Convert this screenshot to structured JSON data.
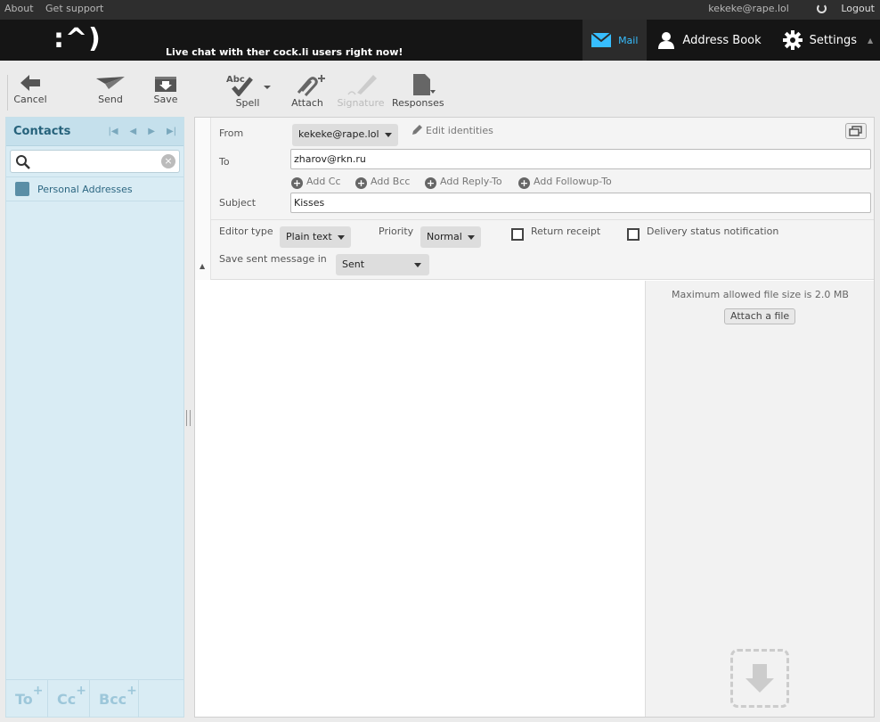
{
  "topline": {
    "about": "About",
    "support": "Get support",
    "user": "kekeke@rape.lol",
    "logout": "Logout"
  },
  "header": {
    "logo": ":^)",
    "motd": "Live chat with ther cock.li users right now!",
    "tasks": {
      "mail": "Mail",
      "addressbook": "Address Book",
      "settings": "Settings"
    }
  },
  "toolbar": {
    "cancel": "Cancel",
    "send": "Send",
    "save": "Save",
    "spell": "Spell",
    "spell_abc": "Abc",
    "attach": "Attach",
    "signature": "Signature",
    "responses": "Responses"
  },
  "sidebar": {
    "title": "Contacts",
    "search_value": "",
    "groups": [
      "Personal Addresses"
    ],
    "footer": {
      "to": "To",
      "cc": "Cc",
      "bcc": "Bcc"
    }
  },
  "compose": {
    "from_label": "From",
    "from_value": "kekeke@rape.lol",
    "edit_identities": "Edit identities",
    "to_label": "To",
    "to_value": "zharov@rkn.ru",
    "add_cc": "Add Cc",
    "add_bcc": "Add Bcc",
    "add_replyto": "Add Reply-To",
    "add_followupto": "Add Followup-To",
    "subject_label": "Subject",
    "subject_value": "Kisses",
    "editor_type_label": "Editor type",
    "editor_type_value": "Plain text",
    "priority_label": "Priority",
    "priority_value": "Normal",
    "return_receipt": "Return receipt",
    "dsn": "Delivery status notification",
    "save_sent_label": "Save sent message in",
    "save_sent_value": "Sent",
    "body": ""
  },
  "attachments": {
    "max_size": "Maximum allowed file size is 2.0 MB",
    "attach_file": "Attach a file"
  },
  "colors": {
    "accent": "#37beff",
    "header_bg": "#151515",
    "sidebar_bg": "#d9ecf4"
  }
}
